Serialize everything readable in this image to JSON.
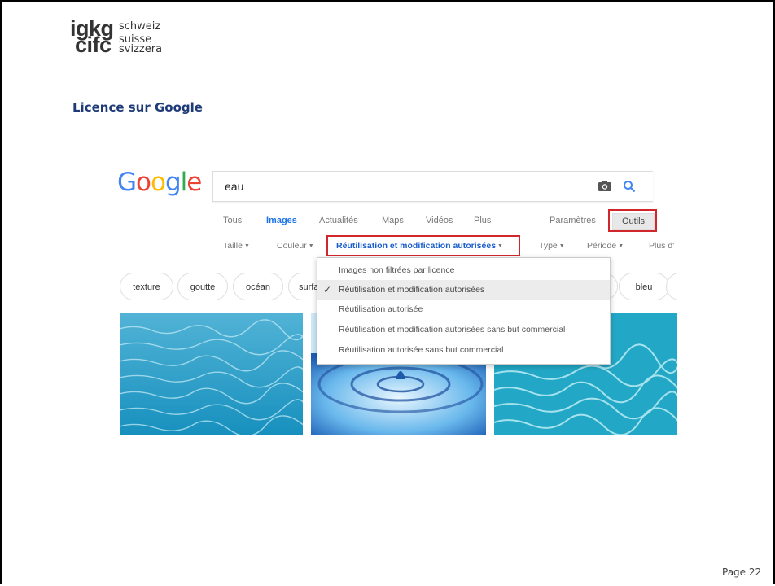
{
  "logo": {
    "line1_big": "igkg",
    "line1_small": "schweiz",
    "line2_big": "cifc",
    "line2_small_a": "suisse",
    "line2_small_b": "svizzera"
  },
  "slide": {
    "title": "Licence sur Google",
    "page": "Page 22"
  },
  "google": {
    "logo": [
      "G",
      "o",
      "o",
      "g",
      "l",
      "e"
    ],
    "search_value": "eau",
    "tabs": [
      "Tous",
      "Images",
      "Actualités",
      "Maps",
      "Vidéos",
      "Plus"
    ],
    "active_tab": "Images",
    "settings": "Paramètres",
    "tools": "Outils",
    "filters": [
      "Taille",
      "Couleur"
    ],
    "active_filter": "Réutilisation et modification autorisées",
    "filters_right": [
      "Type",
      "Période",
      "Plus d'"
    ],
    "chips": [
      "texture",
      "goutte",
      "océan",
      "surfa",
      "bleu"
    ],
    "dropdown": [
      "Images non filtrées par licence",
      "Réutilisation et modification autorisées",
      "Réutilisation autorisée",
      "Réutilisation et modification autorisées sans but commercial",
      "Réutilisation autorisée sans but commercial"
    ],
    "dropdown_selected": "Réutilisation et modification autorisées",
    "accent_color": "#1a73e8",
    "highlight_color": "#d2262d"
  }
}
